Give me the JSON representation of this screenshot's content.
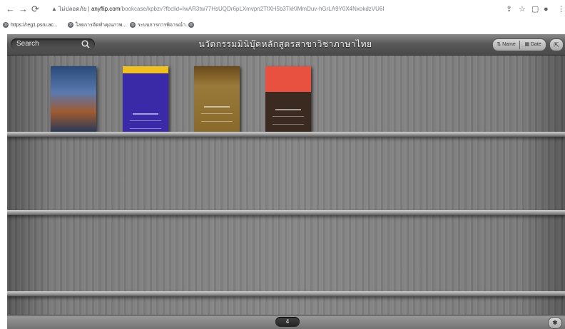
{
  "browser": {
    "url_warning": "ไม่ปลอดภัย",
    "url_host": "anyflip.com",
    "url_path": "/bookcase/kpbzv?fbclid=IwAR3tw77HsUQDr6pLXmvpn2TfXH5b3TkKlMmDuv-hGrLA9Y0X4NxokdzVU6I",
    "bookmarks": [
      {
        "label": "https://reg1.psru.ac..."
      },
      {
        "label": "ไลยการจัดทำคุณภาพ..."
      },
      {
        "label": "ระบบการการพิจารณ์า..."
      },
      {
        "label": ""
      }
    ]
  },
  "app": {
    "search_label": "Search",
    "title": "นวัตกรรมมินิบุ๊คหลักสูตรสาขาวิชาภาษาไทย",
    "sort_name_label": "Name",
    "sort_date_label": "Date",
    "page_number": "4",
    "colors": {
      "book1": "#3a6a9a",
      "book2": "#3b2aa8",
      "book3": "#8a6a2a",
      "book4": "#3a2a20",
      "book4_top": "#e85040"
    }
  },
  "books": [
    {
      "cover_text": ""
    },
    {
      "cover_text": ""
    },
    {
      "cover_text": ""
    },
    {
      "cover_text": ""
    }
  ]
}
